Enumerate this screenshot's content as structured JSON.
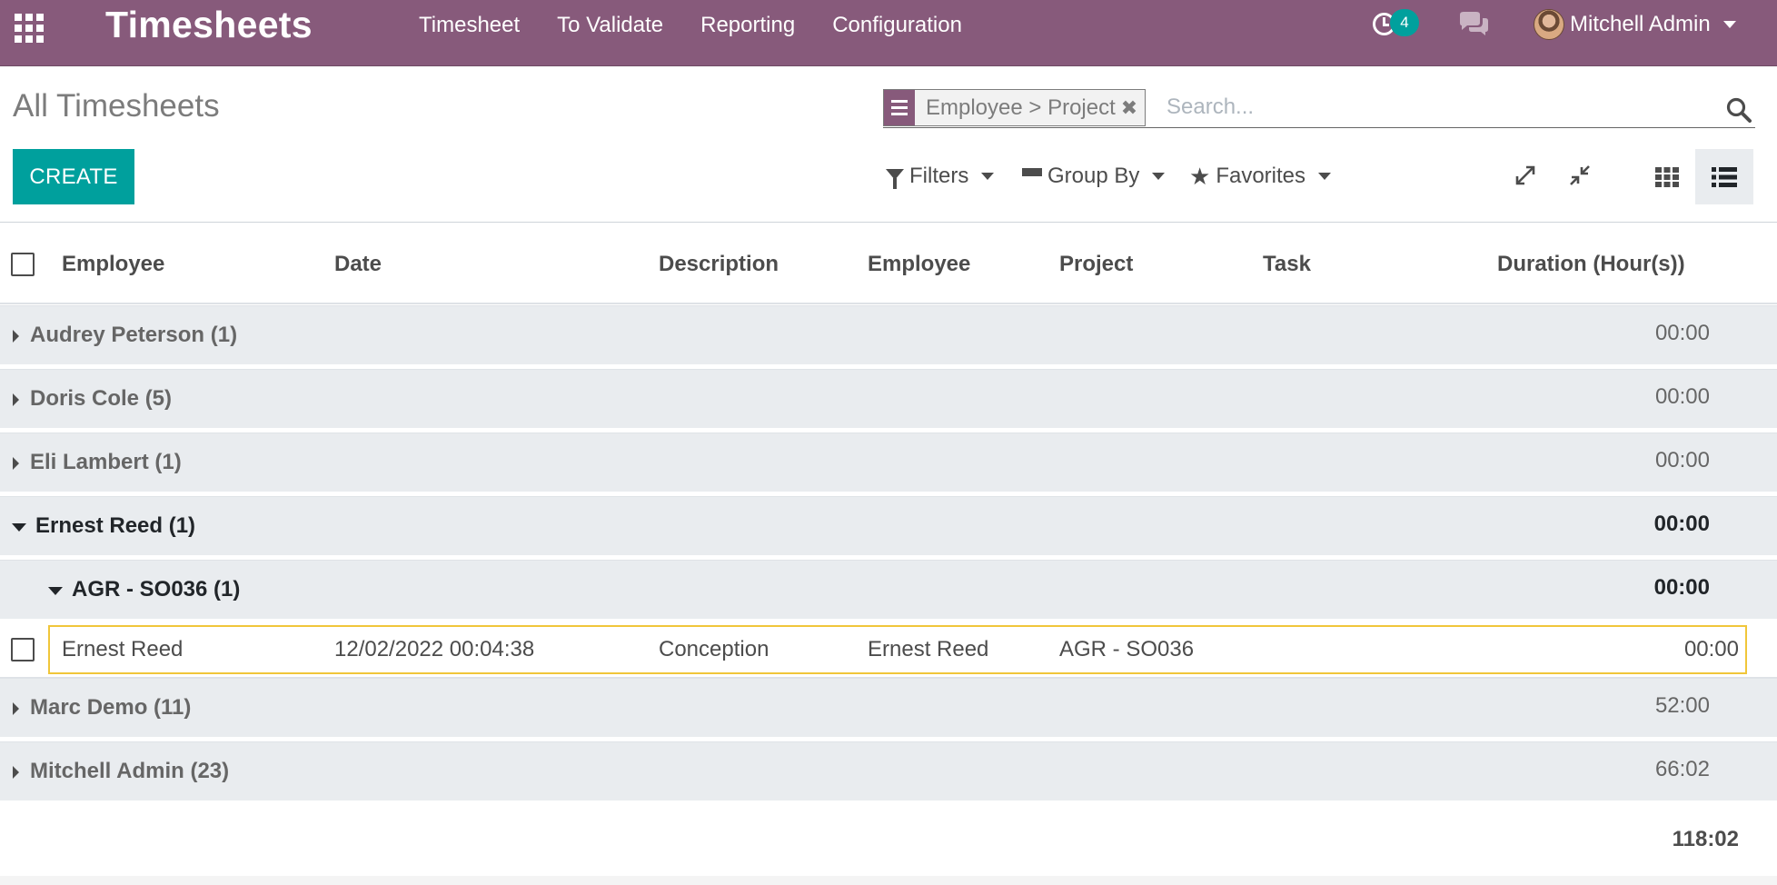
{
  "navbar": {
    "app_title": "Timesheets",
    "menu": [
      "Timesheet",
      "To Validate",
      "Reporting",
      "Configuration"
    ],
    "activity_count": "4",
    "user_name": "Mitchell Admin",
    "brand_color": "#875a7b"
  },
  "control_panel": {
    "breadcrumb": "All Timesheets",
    "create_label": "CREATE",
    "search": {
      "facet": "Employee > Project",
      "placeholder": "Search..."
    },
    "filters_label": "Filters",
    "groupby_label": "Group By",
    "favorites_label": "Favorites",
    "active_view": "list"
  },
  "list": {
    "columns": [
      "Employee",
      "Date",
      "Description",
      "Employee",
      "Project",
      "Task",
      "Duration (Hour(s))"
    ],
    "groups": [
      {
        "name": "Audrey Peterson (1)",
        "total": "00:00",
        "open": false
      },
      {
        "name": "Doris Cole (5)",
        "total": "00:00",
        "open": false
      },
      {
        "name": "Eli Lambert (1)",
        "total": "00:00",
        "open": false
      },
      {
        "name": "Ernest Reed (1)",
        "total": "00:00",
        "open": true
      },
      {
        "name": "Marc Demo (11)",
        "total": "52:00",
        "open": false
      },
      {
        "name": "Mitchell Admin (23)",
        "total": "66:02",
        "open": false
      }
    ],
    "subgroup": {
      "name": "AGR - SO036 (1)",
      "total": "00:00"
    },
    "record": {
      "employee": "Ernest Reed",
      "date": "12/02/2022 00:04:38",
      "description": "Conception",
      "employee2": "Ernest Reed",
      "project": "AGR - SO036",
      "task": "",
      "duration": "00:00"
    },
    "grand_total": "118:02"
  },
  "colors": {
    "accent": "#00a09d",
    "group_bg": "#e9ecef",
    "focus_border": "#f0c63a"
  }
}
